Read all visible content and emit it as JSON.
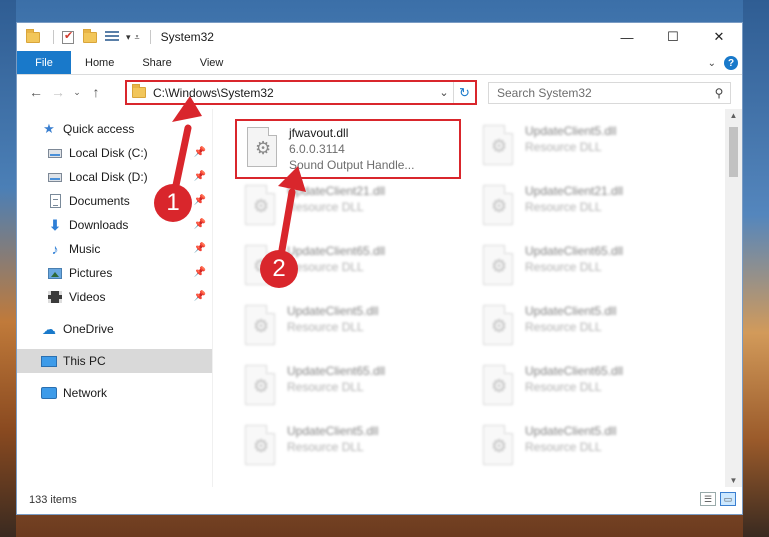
{
  "window": {
    "title": "System32",
    "controls": {
      "minimize": "—",
      "maximize": "☐",
      "close": "✕"
    }
  },
  "ribbon": {
    "file": "File",
    "tabs": [
      "Home",
      "Share",
      "View"
    ],
    "expand_icon": "chevron-down-icon",
    "help": "?"
  },
  "address": {
    "path": "C:\\Windows\\System32",
    "search_placeholder": "Search System32"
  },
  "sidebar": {
    "quick_access": "Quick access",
    "items": [
      {
        "label": "Local Disk (C:)",
        "icon": "drive-icon"
      },
      {
        "label": "Local Disk (D:)",
        "icon": "drive-icon"
      },
      {
        "label": "Documents",
        "icon": "documents-icon"
      },
      {
        "label": "Downloads",
        "icon": "downloads-icon"
      },
      {
        "label": "Music",
        "icon": "music-icon"
      },
      {
        "label": "Pictures",
        "icon": "pictures-icon"
      },
      {
        "label": "Videos",
        "icon": "videos-icon"
      }
    ],
    "onedrive": "OneDrive",
    "thispc": "This PC",
    "network": "Network"
  },
  "files": {
    "highlighted": {
      "name": "jfwavout.dll",
      "version": "6.0.0.3114",
      "description": "Sound Output Handle..."
    },
    "left_column": [
      {
        "name": "UpdateClient21.dll",
        "type": "Resource DLL"
      },
      {
        "name": "UpdateClient65.dll",
        "type": "Resource DLL"
      },
      {
        "name": "UpdateClient5.dll",
        "type": "Resource DLL"
      },
      {
        "name": "UpdateClient65.dll",
        "type": "Resource DLL"
      },
      {
        "name": "UpdateClient5.dll",
        "type": "Resource DLL"
      }
    ],
    "right_column": [
      {
        "name": "UpdateClient5.dll",
        "type": "Resource DLL"
      },
      {
        "name": "UpdateClient21.dll",
        "type": "Resource DLL"
      },
      {
        "name": "UpdateClient65.dll",
        "type": "Resource DLL"
      },
      {
        "name": "UpdateClient5.dll",
        "type": "Resource DLL"
      },
      {
        "name": "UpdateClient65.dll",
        "type": "Resource DLL"
      },
      {
        "name": "UpdateClient5.dll",
        "type": "Resource DLL"
      }
    ]
  },
  "status": {
    "count": "133 items"
  },
  "annotations": {
    "step1": "1",
    "step2": "2",
    "color": "#d9262c"
  }
}
